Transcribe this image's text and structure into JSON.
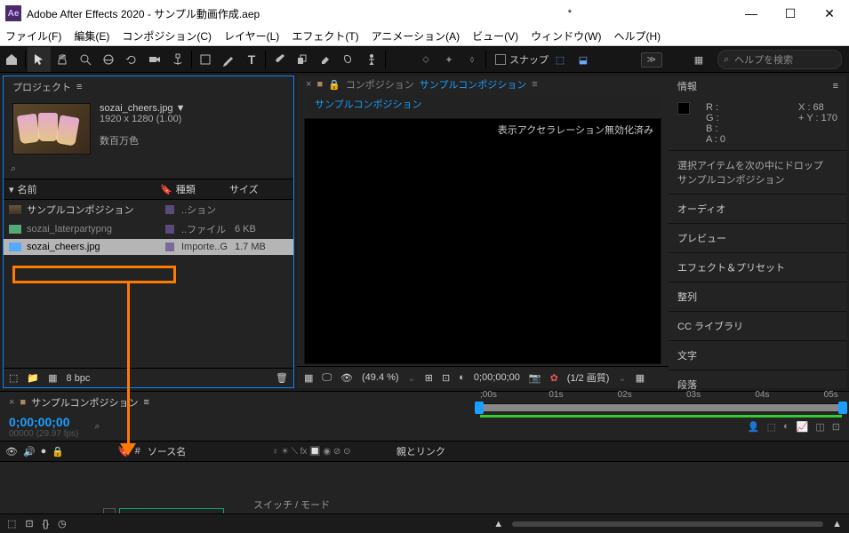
{
  "window": {
    "title": "Adobe After Effects 2020 - サンプル動画作成.aep",
    "modified_indicator": "*",
    "logo_text": "Ae"
  },
  "menu": [
    "ファイル(F)",
    "編集(E)",
    "コンポジション(C)",
    "レイヤー(L)",
    "エフェクト(T)",
    "アニメーション(A)",
    "ビュー(V)",
    "ウィンドウ(W)",
    "ヘルプ(H)"
  ],
  "toolbar": {
    "snap_label": "スナップ",
    "expand_label": "≫",
    "search_placeholder": "ヘルプを検索"
  },
  "project": {
    "panel_title": "プロジェクト",
    "menu_glyph": "≡",
    "preview": {
      "filename": "sozai_cheers.jpg ▼",
      "dimensions": "1920 x 1280 (1.00)",
      "colors": "数百万色"
    },
    "columns": {
      "name": "名前",
      "type": "種類",
      "size": "サイズ"
    },
    "rows": [
      {
        "name": "サンプルコンポジション",
        "type": "..ション",
        "size": ""
      },
      {
        "name": "sozai_laterpartypng",
        "type": "..ファイル",
        "size": "6 KB"
      },
      {
        "name": "sozai_cheers.jpg",
        "type": "Importe..G",
        "size": "1.7 MB",
        "selected": true
      }
    ],
    "footer": {
      "bpc": "8 bpc"
    }
  },
  "composition": {
    "prefix": "コンポジション",
    "name": "サンプルコンポジション",
    "tab_label": "サンプルコンポジション",
    "viewer_note": "表示アクセラレーション無効化済み",
    "footer": {
      "zoom": "(49.4 %)",
      "time": "0;00;00;00",
      "quality": "(1/2 画質)"
    }
  },
  "info_panel": {
    "title": "情報",
    "rgba": {
      "r": "R :",
      "g": "G :",
      "b": "B :",
      "a": "A :   0"
    },
    "xy": {
      "x": "X : 68",
      "y": "Y : 170"
    },
    "drop_hint_1": "選択アイテムを次の中にドロップ",
    "drop_hint_2": "サンプルコンポジション"
  },
  "side_panels": [
    "オーディオ",
    "プレビュー",
    "エフェクト＆プリセット",
    "整列",
    "CC ライブラリ",
    "文字",
    "段落"
  ],
  "timeline": {
    "tab": "サンプルコンポジション",
    "timecode": "0;00;00;00",
    "timecode_sub": "00000 (29.97 fps)",
    "columns": {
      "source": "ソース名",
      "switches": "♀ ☀ ⟍ fx 🔲 ◉ ⊘ ⊙",
      "parent": "親とリンク"
    },
    "ruler_ticks": [
      ";00s",
      "01s",
      "02s",
      "03s",
      "04s",
      "05s"
    ],
    "switch_mode": "スイッチ / モード"
  }
}
